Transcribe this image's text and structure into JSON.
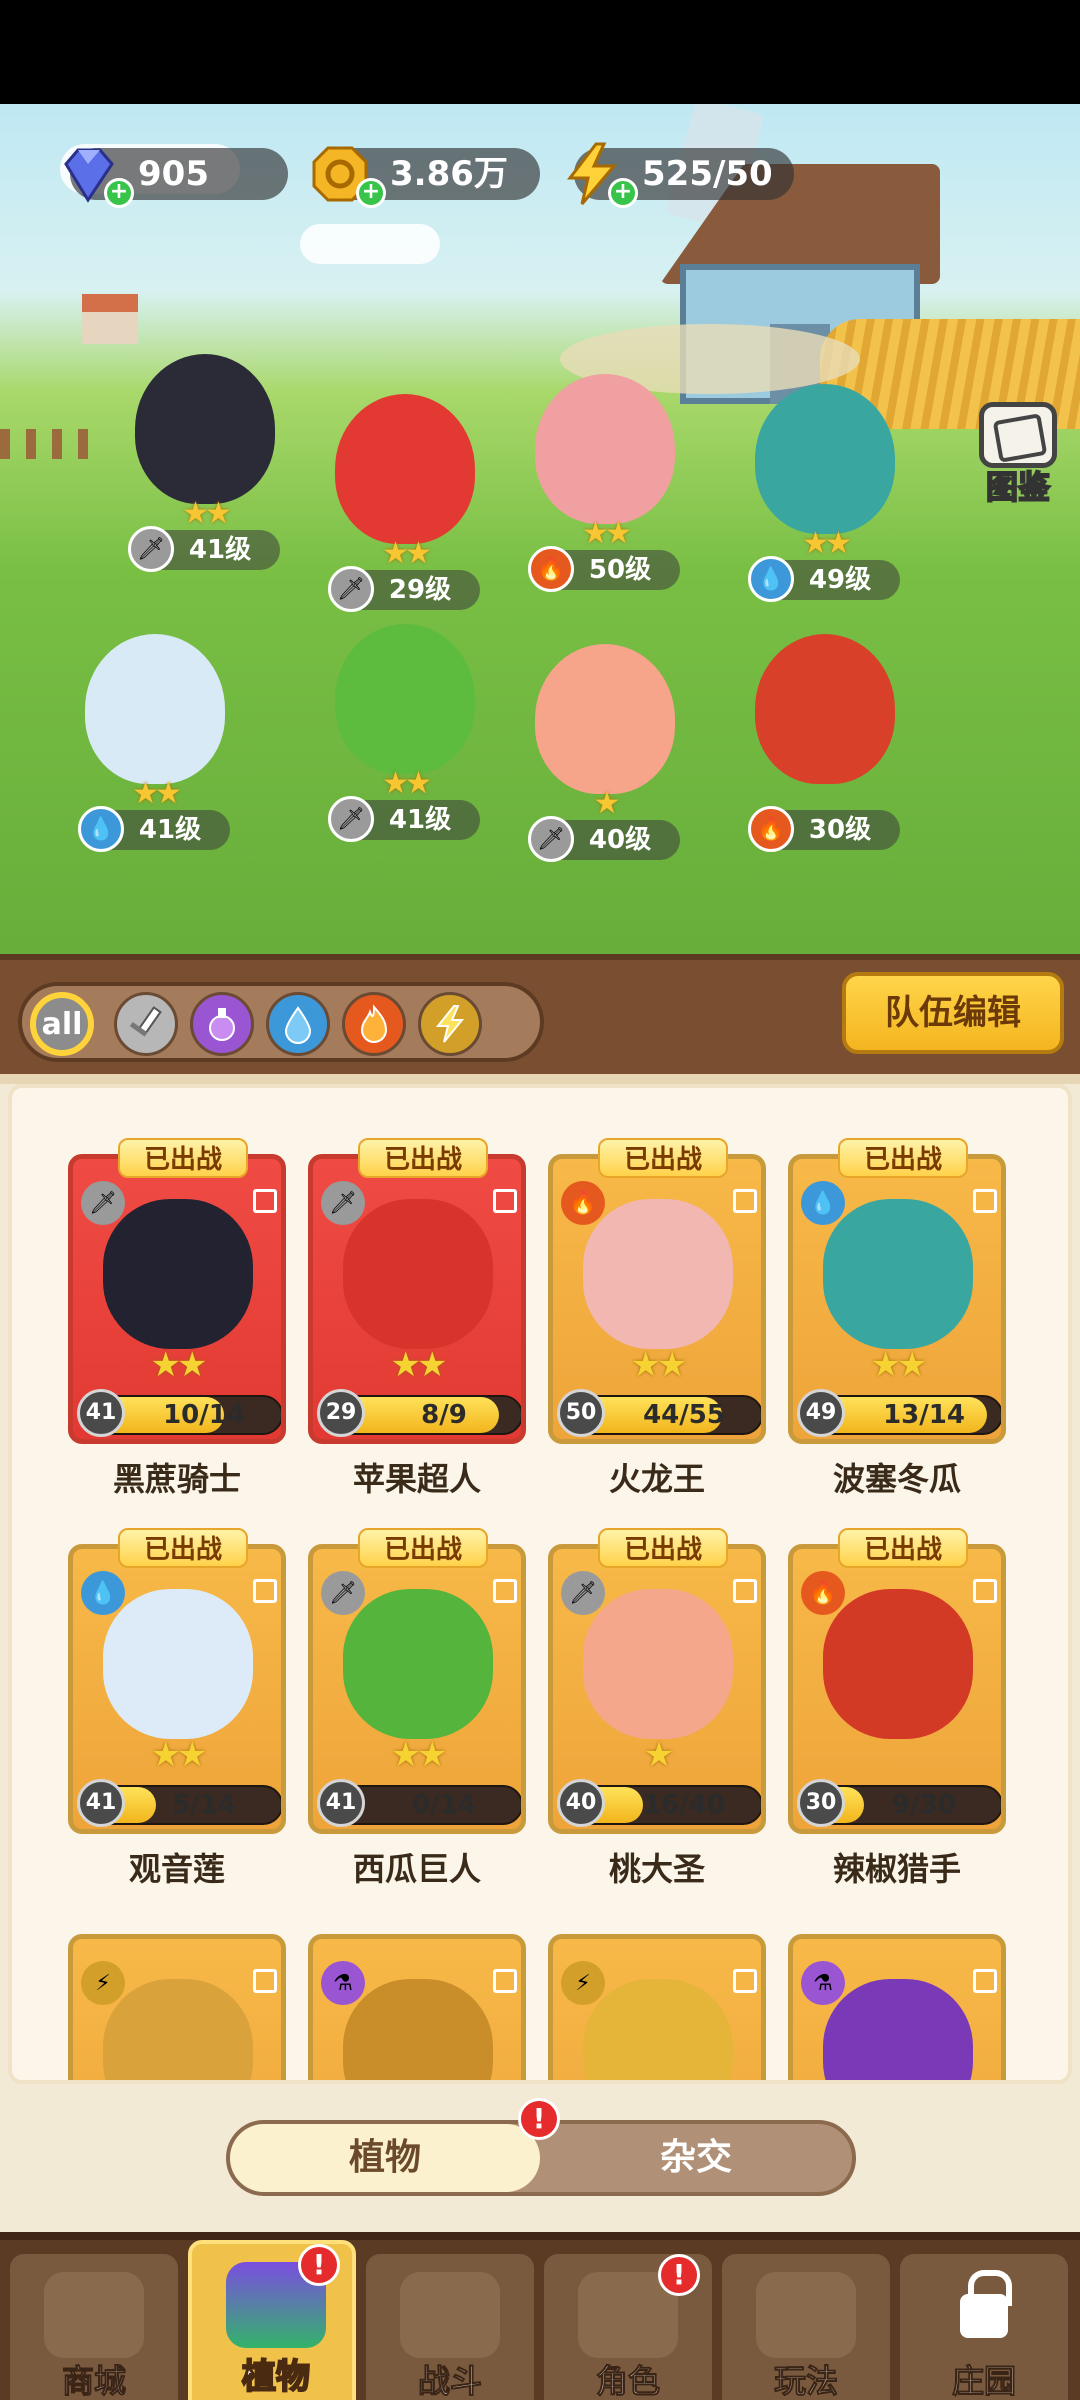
{
  "currencies": {
    "gems": "905",
    "gold": "3.86万",
    "energy": "525/50"
  },
  "codex_label": "图鉴",
  "field_units": [
    {
      "level": "41级",
      "element": "sword",
      "stars": "★★",
      "color": "#2b2b38"
    },
    {
      "level": "29级",
      "element": "sword",
      "stars": "★★",
      "color": "#e23a32"
    },
    {
      "level": "50级",
      "element": "fire",
      "stars": "★★",
      "color": "#f0a0a0"
    },
    {
      "level": "49级",
      "element": "water",
      "stars": "★★",
      "color": "#3aa6a0"
    },
    {
      "level": "41级",
      "element": "water",
      "stars": "★★",
      "color": "#d9eaf7"
    },
    {
      "level": "41级",
      "element": "sword",
      "stars": "★★",
      "color": "#5dbb3e"
    },
    {
      "level": "40级",
      "element": "sword",
      "stars": "★",
      "color": "#f6a48a"
    },
    {
      "level": "30级",
      "element": "fire",
      "stars": "",
      "color": "#d8402a"
    }
  ],
  "filters": {
    "all_label": "all",
    "icons": [
      "sword-icon",
      "potion-icon",
      "water-icon",
      "fire-icon",
      "lightning-icon"
    ]
  },
  "team_edit_label": "队伍编辑",
  "deployed_label": "已出战",
  "cards": [
    {
      "name": "黑蔗骑士",
      "level": "41",
      "progress": "10/14",
      "fill": 0.71,
      "element": "sword",
      "stars": "★★",
      "theme": "red",
      "color": "#222230"
    },
    {
      "name": "苹果超人",
      "level": "29",
      "progress": "8/9",
      "fill": 0.89,
      "element": "sword",
      "stars": "★★",
      "theme": "red",
      "color": "#d9342c"
    },
    {
      "name": "火龙王",
      "level": "50",
      "progress": "44/55",
      "fill": 0.8,
      "element": "fire",
      "stars": "★★",
      "theme": "gold",
      "color": "#f2b7b0"
    },
    {
      "name": "波塞冬瓜",
      "level": "49",
      "progress": "13/14",
      "fill": 0.93,
      "element": "water",
      "stars": "★★",
      "theme": "gold",
      "color": "#3aa6a0"
    },
    {
      "name": "观音莲",
      "level": "41",
      "progress": "5/14",
      "fill": 0.36,
      "element": "water",
      "stars": "★★",
      "theme": "gold",
      "color": "#dcebf7"
    },
    {
      "name": "西瓜巨人",
      "level": "41",
      "progress": "0/14",
      "fill": 0.0,
      "element": "sword",
      "stars": "★★",
      "theme": "gold",
      "color": "#54b43b"
    },
    {
      "name": "桃大圣",
      "level": "40",
      "progress": "16/40",
      "fill": 0.4,
      "element": "sword",
      "stars": "★",
      "theme": "gold",
      "color": "#f4a78a"
    },
    {
      "name": "辣椒猎手",
      "level": "30",
      "progress": "9/30",
      "fill": 0.3,
      "element": "fire",
      "stars": "",
      "theme": "gold",
      "color": "#d23a26"
    }
  ],
  "partial_cards": [
    {
      "element": "lightning",
      "color": "#d9a23a"
    },
    {
      "element": "potion",
      "color": "#c98d2a"
    },
    {
      "element": "lightning",
      "color": "#e5b53a"
    },
    {
      "element": "potion",
      "color": "#7a3ab8"
    }
  ],
  "toggle": {
    "plants_label": "植物",
    "hybrid_label": "杂交",
    "alert": "!"
  },
  "nav": [
    {
      "label": "商城",
      "active": false,
      "alert": ""
    },
    {
      "label": "植物",
      "active": true,
      "alert": "!"
    },
    {
      "label": "战斗",
      "active": false,
      "alert": ""
    },
    {
      "label": "角色",
      "active": false,
      "alert": "!"
    },
    {
      "label": "玩法",
      "active": false,
      "alert": ""
    },
    {
      "label": "庄园",
      "active": false,
      "alert": "",
      "locked": true
    }
  ]
}
